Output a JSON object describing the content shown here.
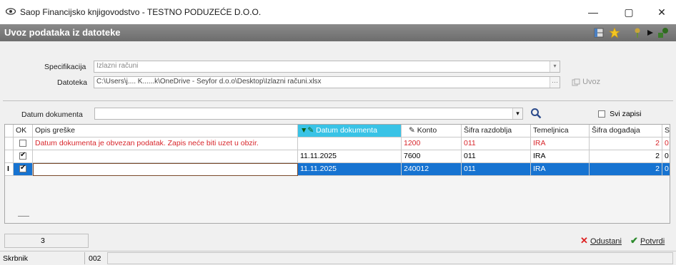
{
  "window": {
    "title": "Saop Financijsko knjigovodstvo - TESTNO PODUZEĆE D.O.O.",
    "min": "—",
    "max": "▢",
    "close": "✕"
  },
  "header": {
    "title": "Uvoz podataka iz datoteke"
  },
  "form": {
    "spec_label": "Specifikacija",
    "spec_value": "Izlazni računi",
    "file_label": "Datoteka",
    "file_value": "C:\\Users\\j.... K......k\\OneDrive - Seyfor d.o.o\\Desktop\\Izlazni računi.xlsx",
    "import_label": "Uvoz"
  },
  "filter": {
    "date_label": "Datum dokumenta",
    "date_value": "",
    "all_records_label": "Svi zapisi"
  },
  "grid": {
    "columns": [
      "",
      "OK",
      "Opis greške",
      "Datum dokumenta",
      "Konto",
      "Šifra razdoblja",
      "Temeljnica",
      "Šifra događaja",
      "S"
    ],
    "rows": [
      {
        "indicator": "",
        "ok": false,
        "error": "Datum dokumenta je obvezan podatak. Zapis neće biti uzet u obzir.",
        "date": "",
        "account": "1200",
        "period": "011",
        "journal": "IRA",
        "event": "2",
        "s": "0"
      },
      {
        "indicator": "",
        "ok": true,
        "error": "",
        "date": "11.11.2025",
        "account": "7600",
        "period": "011",
        "journal": "IRA",
        "event": "2",
        "s": "0"
      },
      {
        "indicator": "I",
        "ok": true,
        "error": "",
        "date": "11.11.2025",
        "account": "240012",
        "period": "011",
        "journal": "IRA",
        "event": "2",
        "s": "0"
      }
    ]
  },
  "footer": {
    "count": "3",
    "cancel_label": "Odustani",
    "confirm_label": "Potvrdi"
  },
  "status": {
    "field1": "Skrbnik",
    "field2": "002"
  },
  "colors": {
    "header_bg": "#7a7a7a",
    "active_col": "#39c3e6",
    "selected_row": "#1673d1",
    "error_text": "#d8262b"
  }
}
